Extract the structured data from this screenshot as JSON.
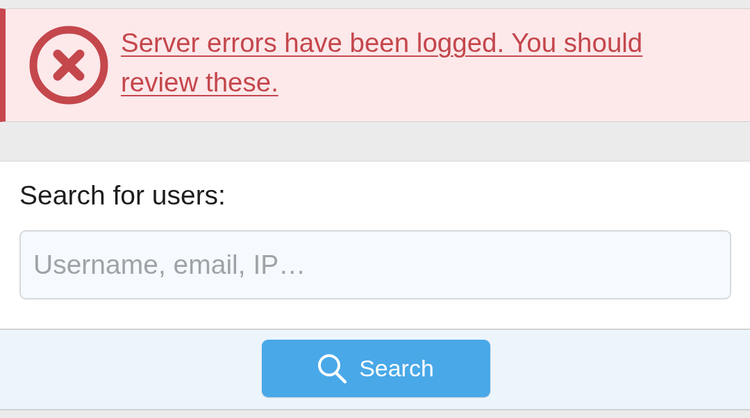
{
  "alert": {
    "kind": "error",
    "message": "Server errors have been logged. You should review these."
  },
  "search_form": {
    "label": "Search for users:",
    "input": {
      "placeholder": "Username, email, IP…"
    },
    "submit_button": {
      "label": "Search"
    }
  }
}
